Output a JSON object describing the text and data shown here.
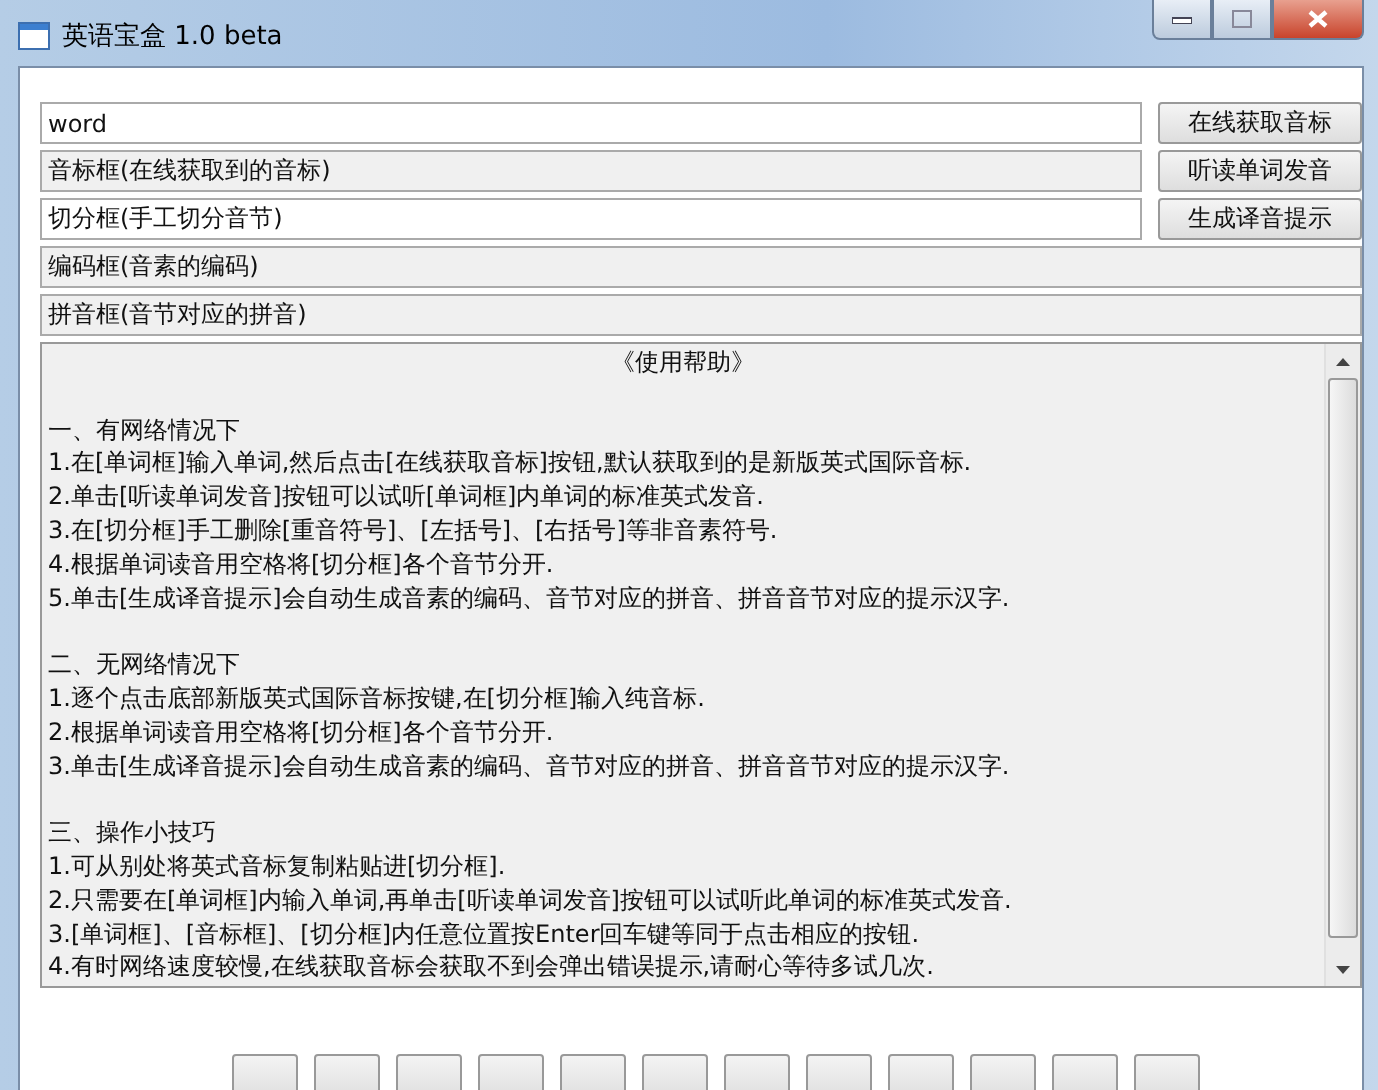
{
  "window": {
    "title": "英语宝盒 1.0 beta"
  },
  "fields": [
    {
      "value": "word",
      "readonly": false,
      "button": "在线获取音标"
    },
    {
      "value": "音标框(在线获取到的音标)",
      "readonly": true,
      "button": "听读单词发音"
    },
    {
      "value": "切分框(手工切分音节)",
      "readonly": false,
      "button": "生成译音提示"
    },
    {
      "value": "编码框(音素的编码)",
      "readonly": true
    },
    {
      "value": "拼音框(音节对应的拼音)",
      "readonly": true
    }
  ],
  "help": {
    "title": "《使用帮助》",
    "sections": [
      {
        "heading": "一、有网络情况下",
        "lines": [
          "1.在[单词框]输入单词,然后点击[在线获取音标]按钮,默认获取到的是新版英式国际音标.",
          "2.单击[听读单词发音]按钮可以试听[单词框]内单词的标准英式发音.",
          "3.在[切分框]手工删除[重音符号]、[左括号]、[右括号]等非音素符号.",
          "4.根据单词读音用空格将[切分框]各个音节分开.",
          "5.单击[生成译音提示]会自动生成音素的编码、音节对应的拼音、拼音音节对应的提示汉字."
        ]
      },
      {
        "heading": "二、无网络情况下",
        "lines": [
          "1.逐个点击底部新版英式国际音标按键,在[切分框]输入纯音标.",
          "2.根据单词读音用空格将[切分框]各个音节分开.",
          "3.单击[生成译音提示]会自动生成音素的编码、音节对应的拼音、拼音音节对应的提示汉字."
        ]
      },
      {
        "heading": "三、操作小技巧",
        "lines": [
          "1.可从别处将英式音标复制粘贴进[切分框].",
          "2.只需要在[单词框]内输入单词,再单击[听读单词发音]按钮可以试听此单词的标准英式发音.",
          "3.[单词框]、[音标框]、[切分框]内任意位置按Enter回车键等同于点击相应的按钮.",
          "4.有时网络速度较慢,在线获取音标会获取不到会弹出错误提示,请耐心等待多试几次."
        ]
      }
    ]
  }
}
